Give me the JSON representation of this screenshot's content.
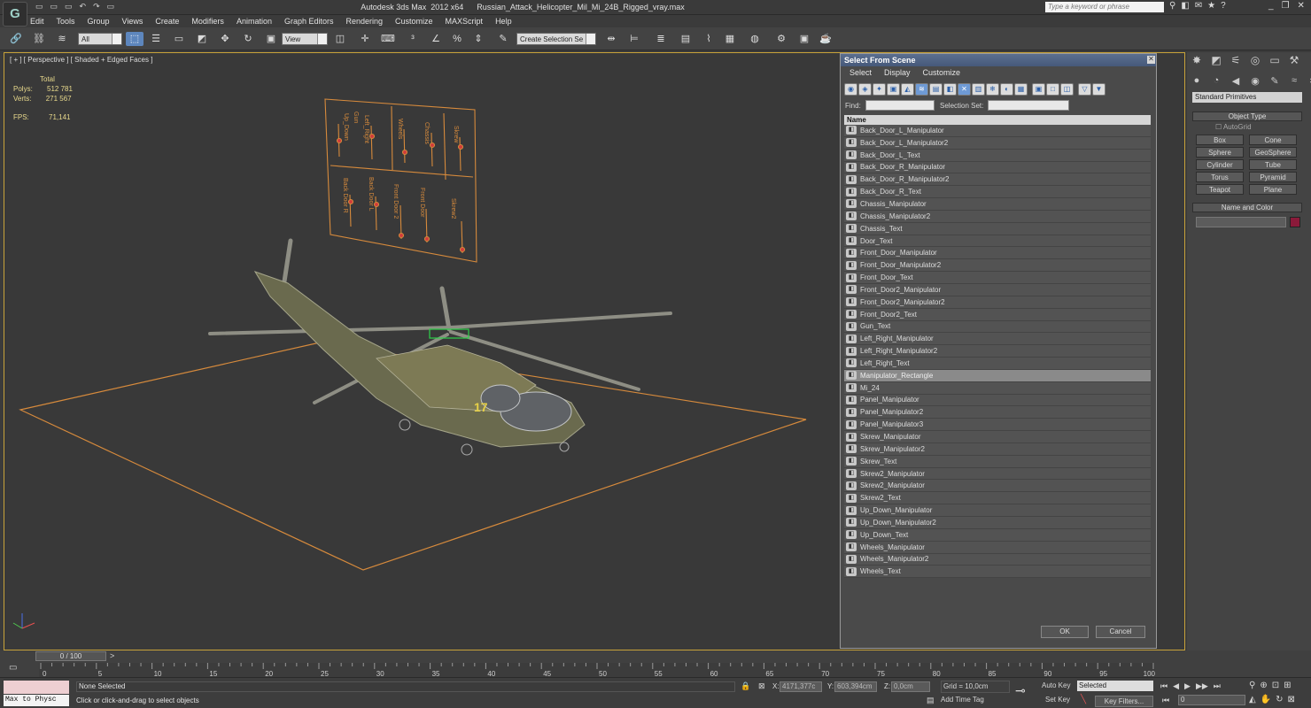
{
  "app": {
    "logo": "G",
    "window_title": "Autodesk 3ds Max  2012 x64      Russian_Attack_Helicopter_Mil_Mi_24B_Rigged_vray.max",
    "search_placeholder": "Type a keyword or phrase",
    "quick_access": [
      "▭",
      "▭",
      "▭",
      "↶",
      "↷",
      "▭"
    ]
  },
  "menu": [
    "Edit",
    "Tools",
    "Group",
    "Views",
    "Create",
    "Modifiers",
    "Animation",
    "Graph Editors",
    "Rendering",
    "Customize",
    "MAXScript",
    "Help"
  ],
  "toolbar": {
    "filter_value": "All",
    "refcoord_value": "View",
    "named_selection": "Create Selection Se"
  },
  "viewport": {
    "label": "[ + ] [ Perspective ] [ Shaded + Edged Faces ]",
    "stats": {
      "total_label": "Total",
      "polys_label": "Polys:",
      "polys": "512 781",
      "verts_label": "Verts:",
      "verts": "271 567",
      "fps_label": "FPS:",
      "fps": "71,141"
    },
    "panel_labels_top": [
      "Gun",
      "Up_Down",
      "Left_Right",
      "Wheels",
      "Chassis",
      "Skrew"
    ],
    "panel_labels_bottom": [
      "Back Door R",
      "Back Door L",
      "Front Door 2",
      "Front Door",
      "Skrew2"
    ],
    "accent_color": "#d68a3c"
  },
  "dialog": {
    "title": "Select From Scene",
    "menu": [
      "Select",
      "Display",
      "Customize"
    ],
    "find_label": "Find:",
    "find_value": "",
    "selset_label": "Selection Set:",
    "selset_value": "",
    "column_header": "Name",
    "ok_label": "OK",
    "cancel_label": "Cancel",
    "selected_item": "Manipulator_Rectangle",
    "items": [
      "Back_Door_L_Manipulator",
      "Back_Door_L_Manipulator2",
      "Back_Door_L_Text",
      "Back_Door_R_Manipulator",
      "Back_Door_R_Manipulator2",
      "Back_Door_R_Text",
      "Chassis_Manipulator",
      "Chassis_Manipulator2",
      "Chassis_Text",
      "Door_Text",
      "Front_Door_Manipulator",
      "Front_Door_Manipulator2",
      "Front_Door_Text",
      "Front_Door2_Manipulator",
      "Front_Door2_Manipulator2",
      "Front_Door2_Text",
      "Gun_Text",
      "Left_Right_Manipulator",
      "Left_Right_Manipulator2",
      "Left_Right_Text",
      "Manipulator_Rectangle",
      "Mi_24",
      "Panel_Manipulator",
      "Panel_Manipulator2",
      "Panel_Manipulator3",
      "Skrew_Manipulator",
      "Skrew_Manipulator2",
      "Skrew_Text",
      "Skrew2_Manipulator",
      "Skrew2_Manipulator",
      "Skrew2_Text",
      "Up_Down_Manipulator",
      "Up_Down_Manipulator2",
      "Up_Down_Text",
      "Wheels_Manipulator",
      "Wheels_Manipulator2",
      "Wheels_Text"
    ]
  },
  "command_panel": {
    "category": "Standard Primitives",
    "object_type_header": "Object Type",
    "autogrid": "AutoGrid",
    "buttons": [
      "Box",
      "Cone",
      "Sphere",
      "GeoSphere",
      "Cylinder",
      "Tube",
      "Torus",
      "Pyramid",
      "Teapot",
      "Plane"
    ],
    "name_color_header": "Name and Color",
    "object_color": "#8b1a3a"
  },
  "timeline": {
    "slider": "0 / 100",
    "ticks": [
      "0",
      "5",
      "10",
      "15",
      "20",
      "25",
      "30",
      "35",
      "40",
      "45",
      "50",
      "55",
      "60",
      "65",
      "70",
      "75",
      "80",
      "85",
      "90",
      "95",
      "100"
    ]
  },
  "status": {
    "maxscript_text": "Max to Physc",
    "selection": "None Selected",
    "prompt": "Click or click-and-drag to select objects",
    "x_label": "X:",
    "x": "4171,377c",
    "y_label": "Y:",
    "y": "603,394cm",
    "z_label": "Z:",
    "z": "0,0cm",
    "grid": "Grid = 10,0cm",
    "add_time_tag": "Add Time Tag",
    "auto_key": "Auto Key",
    "set_key": "Set Key",
    "selected_dd": "Selected",
    "key_filters": "Key Filters...",
    "frame": "0"
  }
}
